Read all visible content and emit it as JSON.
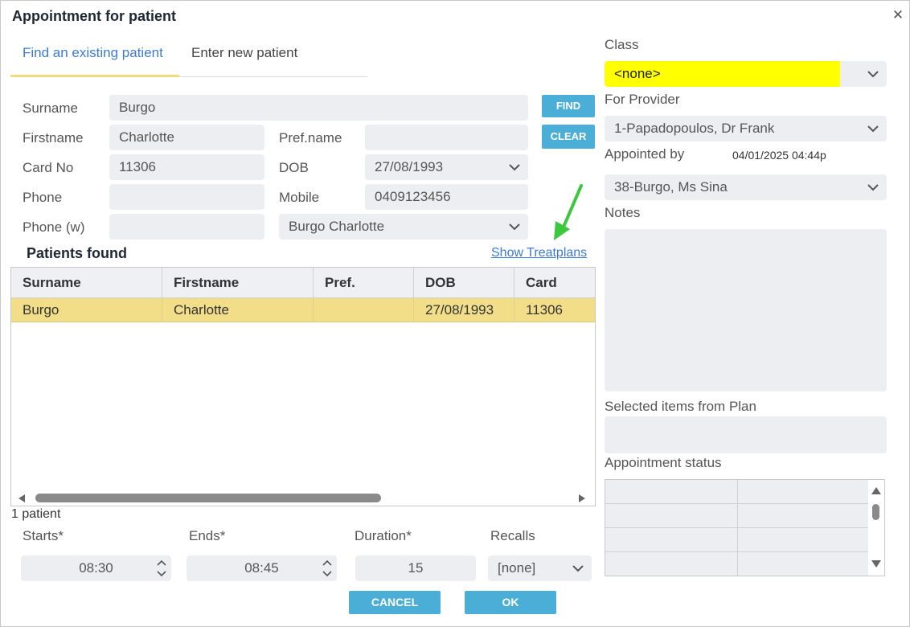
{
  "dialog": {
    "title": "Appointment for patient",
    "close_glyph": "✕"
  },
  "tabs": [
    {
      "label": "Find an existing patient",
      "active": true
    },
    {
      "label": "Enter new patient",
      "active": false
    }
  ],
  "form": {
    "surname_label": "Surname",
    "surname_value": "Burgo",
    "firstname_label": "Firstname",
    "firstname_value": "Charlotte",
    "prefname_label": "Pref.name",
    "prefname_value": "",
    "cardno_label": "Card No",
    "cardno_value": "11306",
    "dob_label": "DOB",
    "dob_value": "27/08/1993",
    "phone_label": "Phone",
    "phone_value": "",
    "mobile_label": "Mobile",
    "mobile_value": "0409123456",
    "phonew_label": "Phone (w)",
    "phonew_value": "",
    "patient_select_value": "Burgo Charlotte",
    "find_label": "FIND",
    "clear_label": "CLEAR"
  },
  "patients": {
    "heading": "Patients found",
    "show_treatplans": "Show Treatplans",
    "columns": [
      "Surname",
      "Firstname",
      "Pref.",
      "DOB",
      "Card"
    ],
    "rows": [
      {
        "surname": "Burgo",
        "firstname": "Charlotte",
        "pref": "",
        "dob": "27/08/1993",
        "card": "11306"
      }
    ],
    "count_text": "1 patient"
  },
  "timing": {
    "starts_label": "Starts*",
    "starts_value": "08:30",
    "ends_label": "Ends*",
    "ends_value": "08:45",
    "duration_label": "Duration*",
    "duration_value": "15",
    "recalls_label": "Recalls",
    "recalls_value": "[none]"
  },
  "actions": {
    "cancel_label": "CANCEL",
    "ok_label": "OK"
  },
  "right": {
    "class_label": "Class",
    "class_value": "<none>",
    "class_color": "#ffff00",
    "provider_label": "For Provider",
    "provider_value": "1-Papadopoulos, Dr Frank",
    "appointed_by_label": "Appointed by",
    "appointed_timestamp": "04/01/2025 04:44p",
    "appointed_by_value": "38-Burgo, Ms Sina",
    "notes_label": "Notes",
    "notes_value": "",
    "selected_items_label": "Selected items from Plan",
    "appointment_status_label": "Appointment status"
  },
  "colors": {
    "accent": "#4aaed6",
    "link": "#3b7bd4",
    "selected_row": "#f2de88",
    "annotation_arrow": "#3cc83c"
  }
}
